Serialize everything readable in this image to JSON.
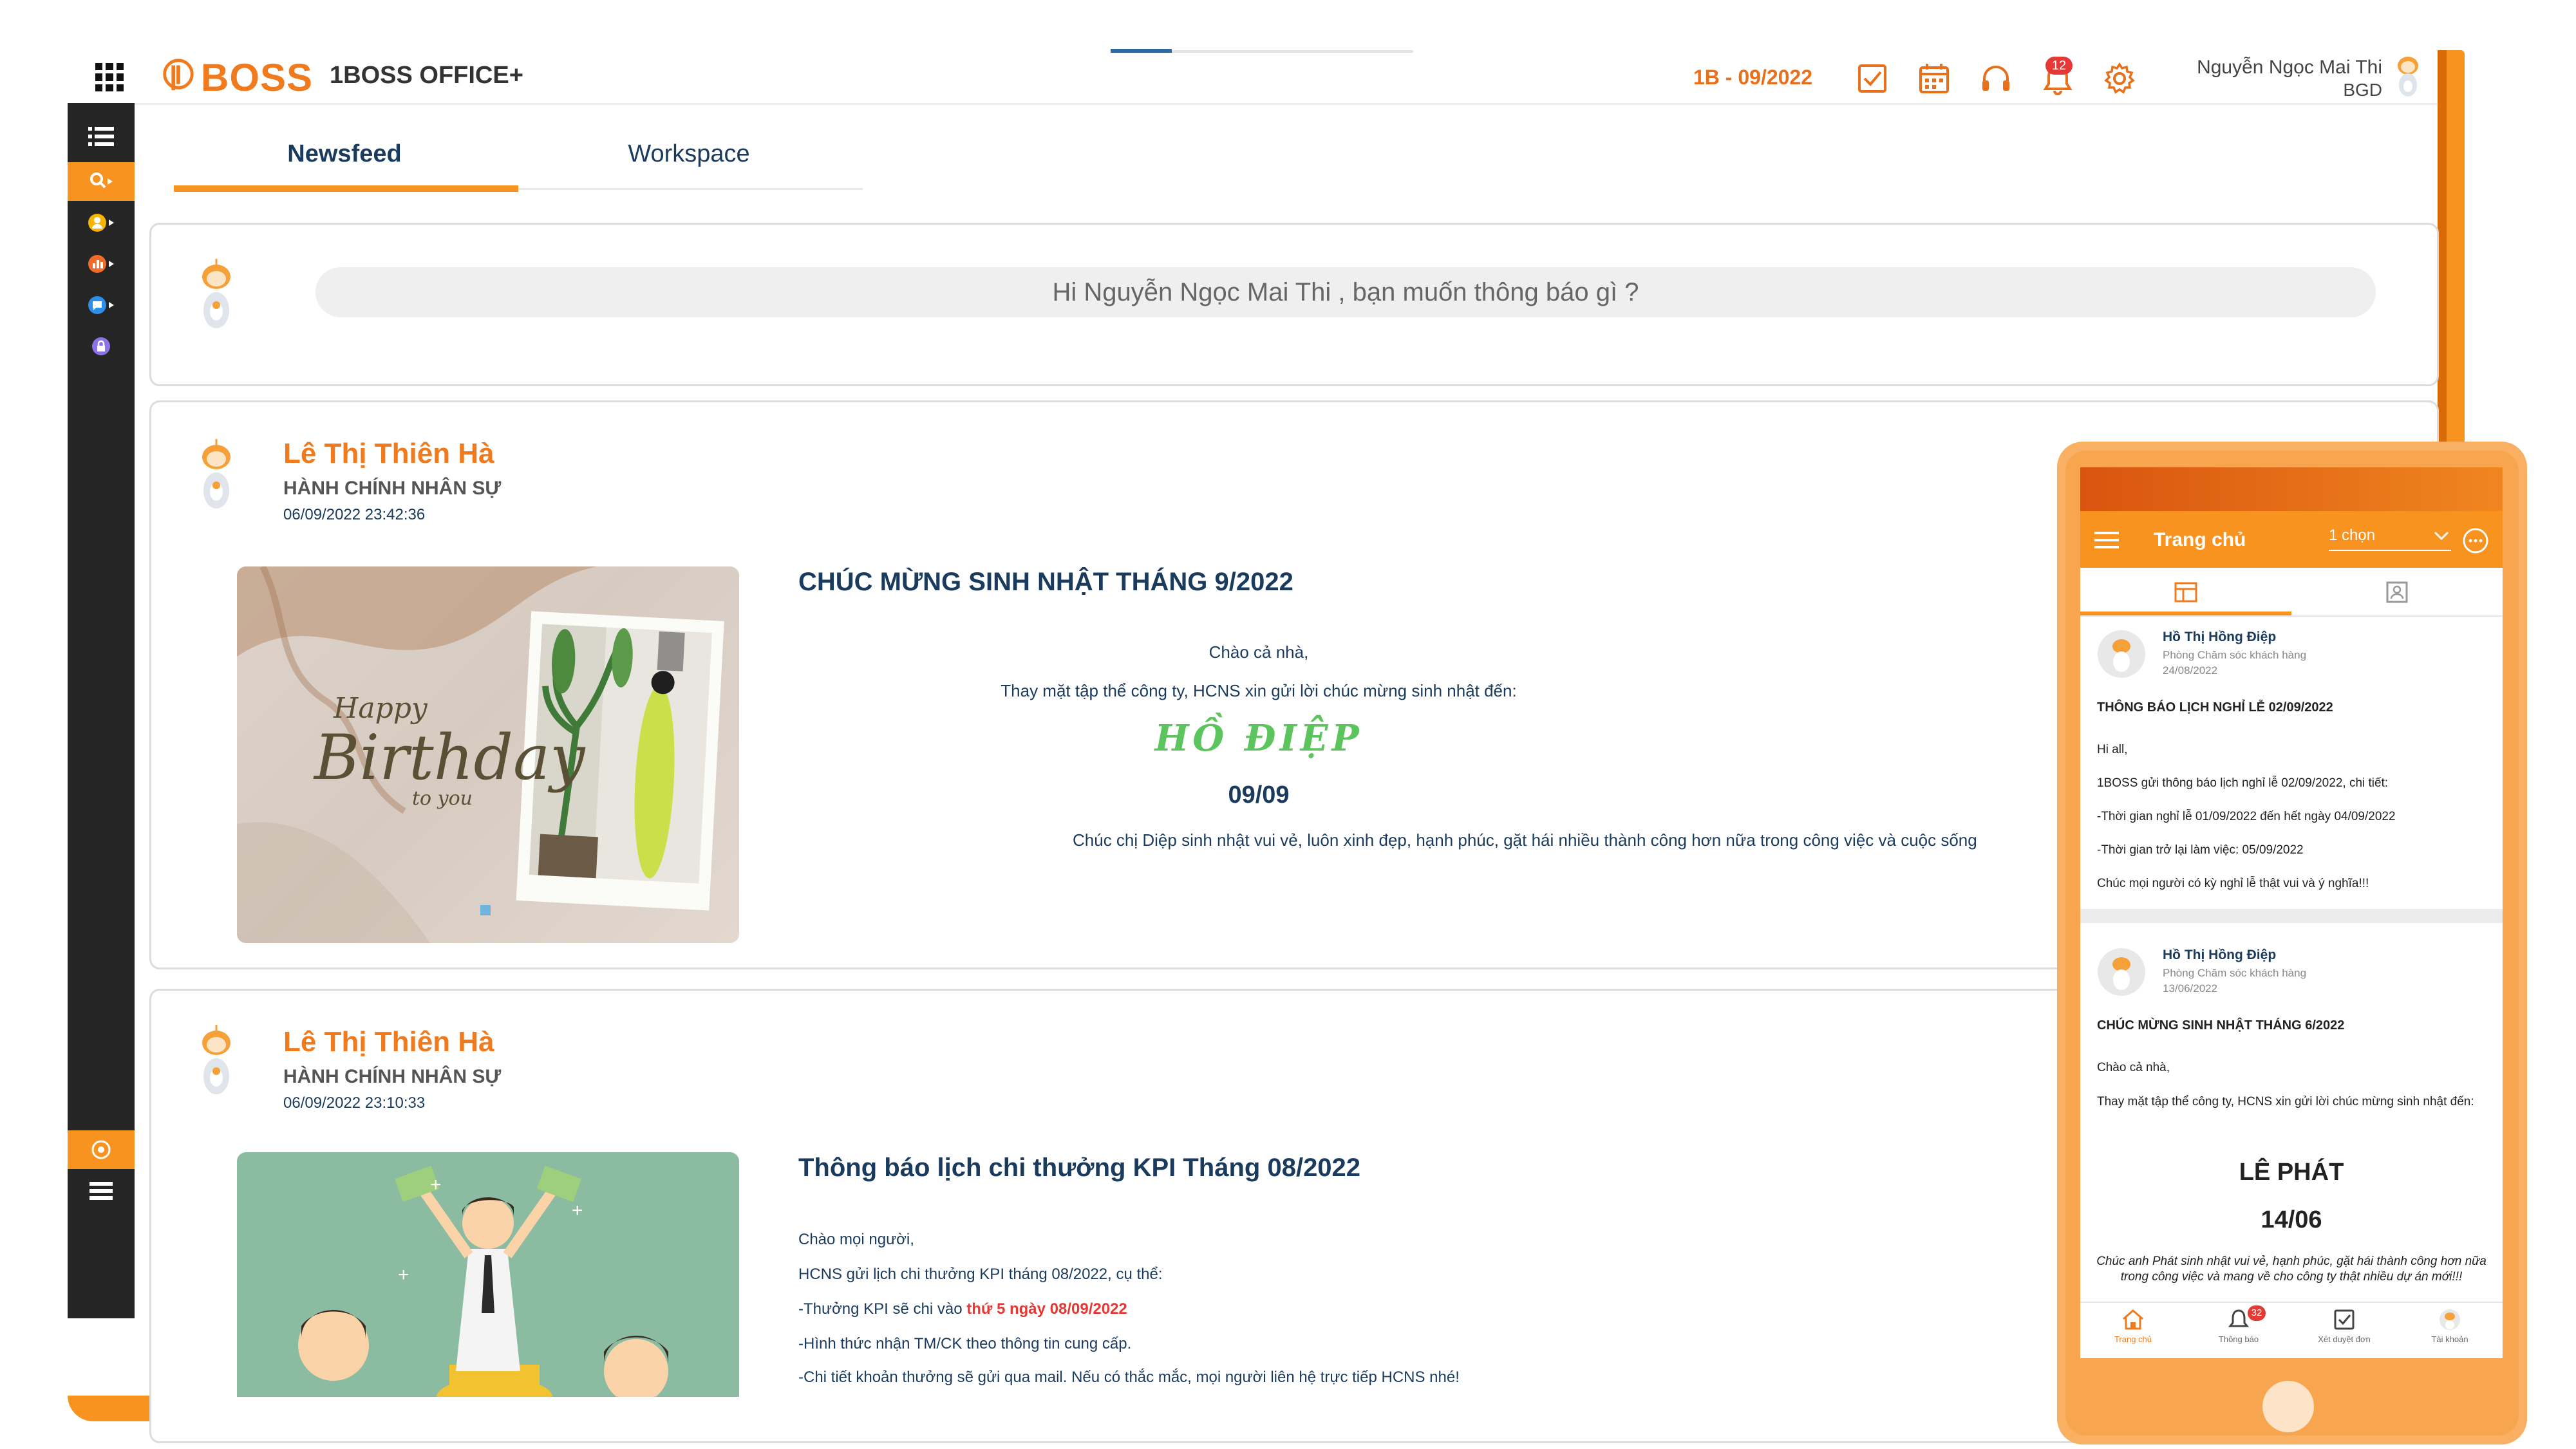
{
  "header": {
    "app_name": "1BOSS OFFICE+",
    "logo_text": "BOSS",
    "period": "1B - 09/2022",
    "notification_count": "12",
    "user_name": "Nguyễn Ngọc Mai Thi",
    "user_role": "BGD",
    "icons": [
      "apps-grid-icon",
      "tasks-check-icon",
      "calendar-icon",
      "headset-icon",
      "bell-icon",
      "gear-icon"
    ]
  },
  "tabs": [
    {
      "label": "Newsfeed",
      "active": true
    },
    {
      "label": "Workspace",
      "active": false
    }
  ],
  "sidebar": {
    "items": [
      "list-icon",
      "search-icon",
      "user-group-icon",
      "chart-icon",
      "message-icon",
      "lock-icon",
      "settings-circle-icon",
      "menu-list-icon"
    ],
    "active_item": "search-icon"
  },
  "composer": {
    "placeholder": "Hi Nguyễn Ngọc Mai Thi , bạn muốn thông báo gì ?"
  },
  "posts": [
    {
      "author": "Lê Thị Thiên Hà",
      "department": "HÀNH CHÍNH NHÂN SỰ",
      "time": "06/09/2022 23:42:36",
      "title": "CHÚC MỪNG SINH NHẬT THÁNG 9/2022",
      "greeting": "Chào cả nhà,",
      "intro": "Thay mặt tập thể công ty, HCNS xin gửi lời chúc mừng sinh nhật đến:",
      "name_highlight": "HỒ ĐIỆP",
      "date_highlight": "09/09",
      "wish": "Chúc chị Diệp sinh nhật vui vẻ, luôn xinh đẹp, hạnh phúc, gặt hái nhiều thành công hơn nữa trong công việc và cuộc sống",
      "image_text": {
        "happy": "Happy",
        "birthday": "Birthday",
        "to_you": "to you"
      }
    },
    {
      "author": "Lê Thị Thiên Hà",
      "department": "HÀNH CHÍNH NHÂN SỰ",
      "time": "06/09/2022 23:10:33",
      "title": "Thông báo lịch chi thưởng KPI Tháng 08/2022",
      "lines": [
        "Chào mọi người,",
        "HCNS gửi lịch chi thưởng KPI tháng 08/2022, cụ thể:",
        "-Hình thức nhận TM/CK theo thông tin cung cấp.",
        "-Chi tiết khoản thưởng sẽ gửi qua mail. Nếu có thắc mắc, mọi người liên hệ trực tiếp HCNS nhé!"
      ],
      "kpi_prefix": "-Thưởng KPI sẽ chi vào ",
      "kpi_date": "thứ 5 ngày 08/09/2022"
    }
  ],
  "mobile": {
    "title": "Trang chủ",
    "filter": "1 chọn",
    "posts": [
      {
        "author": "Hồ Thị Hồng Điệp",
        "department": "Phòng Chăm sóc khách hàng",
        "date": "24/08/2022",
        "title": "THÔNG BÁO LỊCH NGHỈ LỄ 02/09/2022",
        "lines": [
          "Hi all,",
          "1BOSS gửi thông báo lịch nghỉ lễ 02/09/2022, chi tiết:",
          "-Thời gian nghỉ lễ 01/09/2022 đến hết ngày 04/09/2022",
          "-Thời gian trở lại làm việc: 05/09/2022",
          "Chúc mọi người có kỳ nghỉ lễ thật vui và ý nghĩa!!!"
        ]
      },
      {
        "author": "Hồ Thị Hồng Điệp",
        "department": "Phòng Chăm sóc khách hàng",
        "date": "13/06/2022",
        "title": "CHÚC MỪNG SINH NHẬT THÁNG 6/2022",
        "greeting": "Chào cả nhà,",
        "intro": "Thay mặt tập thể công ty, HCNS xin gửi lời chúc mừng sinh nhật đến:",
        "name_highlight": "LÊ PHÁT",
        "date_highlight": "14/06",
        "wish": "Chúc anh Phát sinh nhật vui vẻ, hạnh phúc, gặt hái thành công hơn nữa trong công việc và mang về cho công ty thật nhiều dự án mới!!!"
      }
    ],
    "bottom_nav": [
      {
        "label": "Trang chủ",
        "active": true
      },
      {
        "label": "Thông báo",
        "badge": "32"
      },
      {
        "label": "Xét duyệt đơn"
      },
      {
        "label": "Tài khoản"
      }
    ]
  },
  "colors": {
    "accent": "#f7931e",
    "brand_orange": "#f07b1e",
    "navy": "#1a3b5d",
    "sidebar": "#252525",
    "highlight_green": "#5cc45c",
    "alert_red": "#e53935"
  }
}
